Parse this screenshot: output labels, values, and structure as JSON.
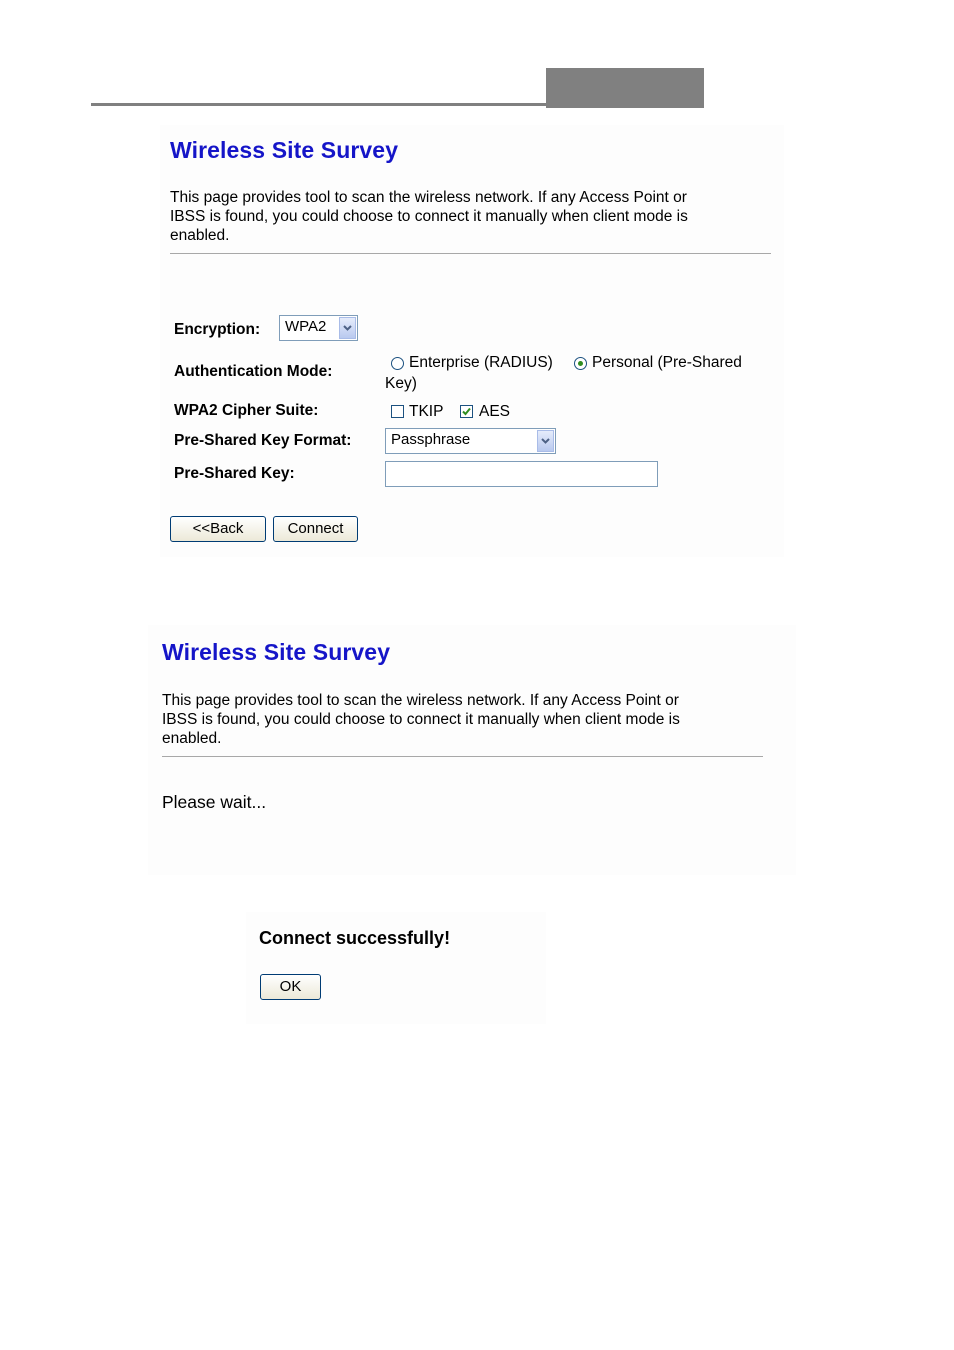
{
  "survey_connect": {
    "title": "Wireless Site Survey",
    "description_lines": [
      "This page provides tool to scan the wireless network. If any Access Point or",
      "IBSS is found, you could choose to connect it manually when client mode is",
      "enabled."
    ],
    "encryption": {
      "label": "Encryption:",
      "selected": "WPA2"
    },
    "auth_mode": {
      "label": "Authentication Mode:",
      "enterprise_label": "Enterprise (RADIUS)",
      "personal_label": "Personal (Pre-Shared",
      "personal_label_wrap": "Key)",
      "selected": "personal"
    },
    "cipher": {
      "label": "WPA2 Cipher Suite:",
      "tkip_label": "TKIP",
      "tkip_checked": false,
      "aes_label": "AES",
      "aes_checked": true
    },
    "psk_format": {
      "label": "Pre-Shared Key Format:",
      "selected": "Passphrase"
    },
    "psk": {
      "label": "Pre-Shared Key:",
      "value": ""
    },
    "back_label": "<<Back",
    "connect_label": "Connect"
  },
  "survey_wait": {
    "title": "Wireless Site Survey",
    "description_lines": [
      "This page provides tool to scan the wireless network. If any Access Point or",
      "IBSS is found, you could choose to connect it manually when client mode is",
      "enabled."
    ],
    "status": "Please wait..."
  },
  "success": {
    "message": "Connect successfully!",
    "ok_label": "OK"
  },
  "colors": {
    "title": "#1515c8",
    "header_bar": "#808080",
    "radio_dot": "#2f8d1f",
    "check_mark": "#2f8d1f"
  }
}
